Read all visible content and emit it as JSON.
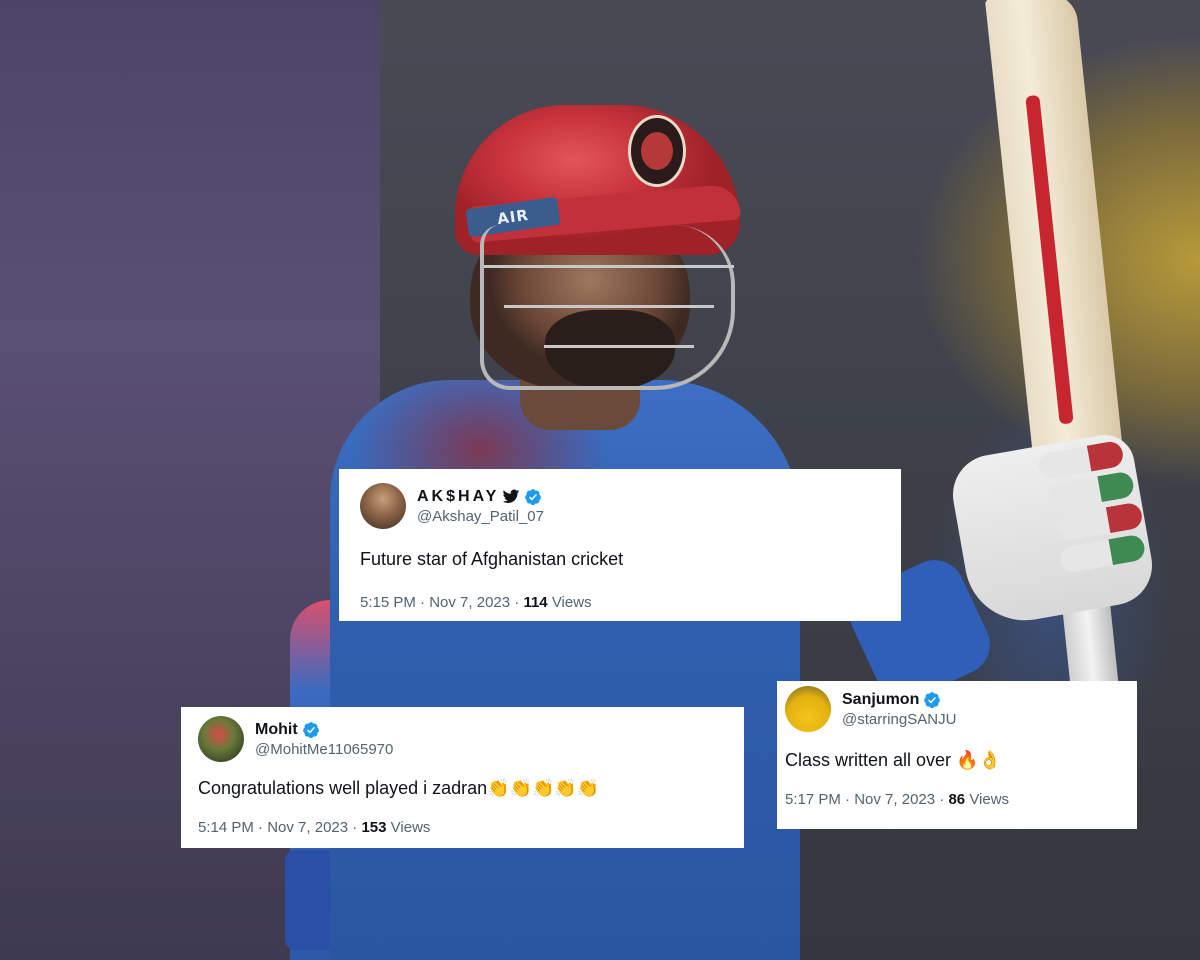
{
  "photo": {
    "helmet_text": "AIR"
  },
  "tweets": [
    {
      "display_name": "AK$HAY",
      "has_bird_icon": true,
      "verified": true,
      "handle": "@Akshay_Patil_07",
      "text": "Future star of Afghanistan cricket",
      "time": "5:15 PM",
      "date": "Nov 7, 2023",
      "views_count": "114",
      "views_label": "Views"
    },
    {
      "display_name": "Mohit",
      "verified": true,
      "handle": "@MohitMe11065970",
      "text": "Congratulations well played i zadran",
      "emojis": "👏👏👏👏👏",
      "time": "5:14 PM",
      "date": "Nov 7, 2023",
      "views_count": "153",
      "views_label": "Views"
    },
    {
      "display_name": "Sanjumon",
      "verified": true,
      "handle": "@starringSANJU",
      "text": "Class written all over",
      "emojis": "🔥👌",
      "time": "5:17 PM",
      "date": "Nov 7, 2023",
      "views_count": "86",
      "views_label": "Views"
    }
  ],
  "separator": "·",
  "colors": {
    "verified_badge": "#1d9bf0",
    "secondary_text": "#536471",
    "primary_text": "#0f1419"
  }
}
